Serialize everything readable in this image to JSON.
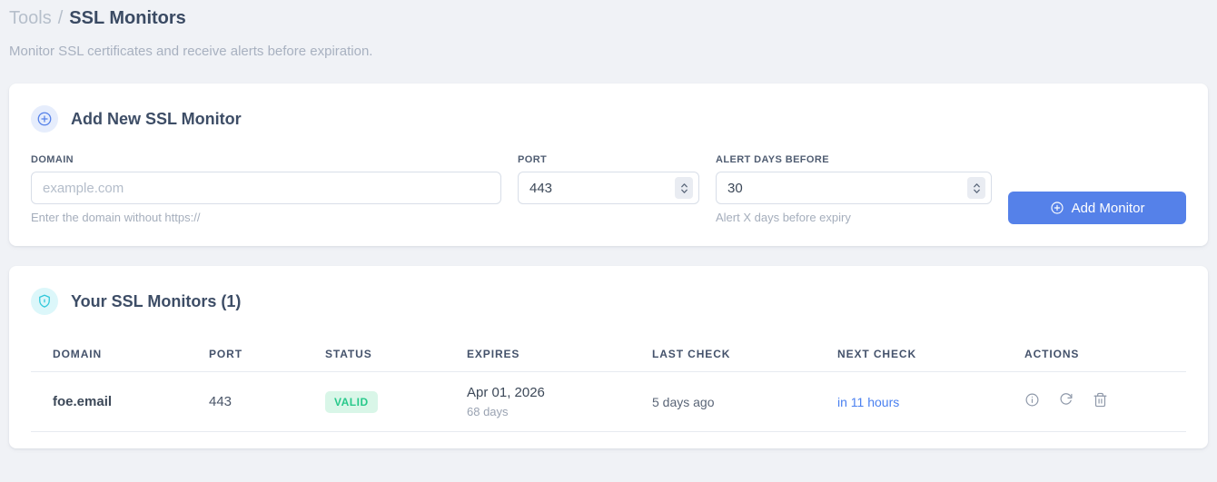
{
  "page": {
    "breadcrumb": {
      "section": "Tools",
      "separator": "/",
      "current": "SSL Monitors"
    },
    "subtitle": "Monitor SSL certificates and receive alerts before expiration."
  },
  "add_monitor": {
    "title": "Add New SSL Monitor",
    "header_icon": "plus-circle-icon",
    "fields": {
      "domain": {
        "label": "DOMAIN",
        "placeholder": "example.com",
        "value": "",
        "helper": "Enter the domain without https://"
      },
      "port": {
        "label": "PORT",
        "value": "443"
      },
      "alert_days_before": {
        "label": "ALERT DAYS BEFORE",
        "value": "30",
        "helper": "Alert X days before expiry"
      }
    },
    "submit_label": "Add Monitor"
  },
  "monitors": {
    "title": "Your SSL Monitors (1)",
    "header_icon": "shield-icon",
    "table": {
      "headers": [
        "DOMAIN",
        "PORT",
        "STATUS",
        "EXPIRES",
        "LAST CHECK",
        "NEXT CHECK",
        "ACTIONS"
      ],
      "rows": [
        {
          "domain": "foe.email",
          "port": "443",
          "status": "VALID",
          "expires_date": "Apr 01, 2026",
          "expires_days": "68 days",
          "last_check": "5 days ago",
          "next_check": "in 11 hours",
          "action_icons": [
            "info-icon",
            "refresh-icon",
            "trash-icon"
          ]
        }
      ]
    }
  },
  "colors": {
    "accent_blue": "#5581e9",
    "link_blue": "#4a80f0",
    "success_text": "#28c98b",
    "success_bg": "#d9f6e8",
    "shield_cyan": "#2ec8da",
    "page_bg": "#f0f2f6"
  }
}
